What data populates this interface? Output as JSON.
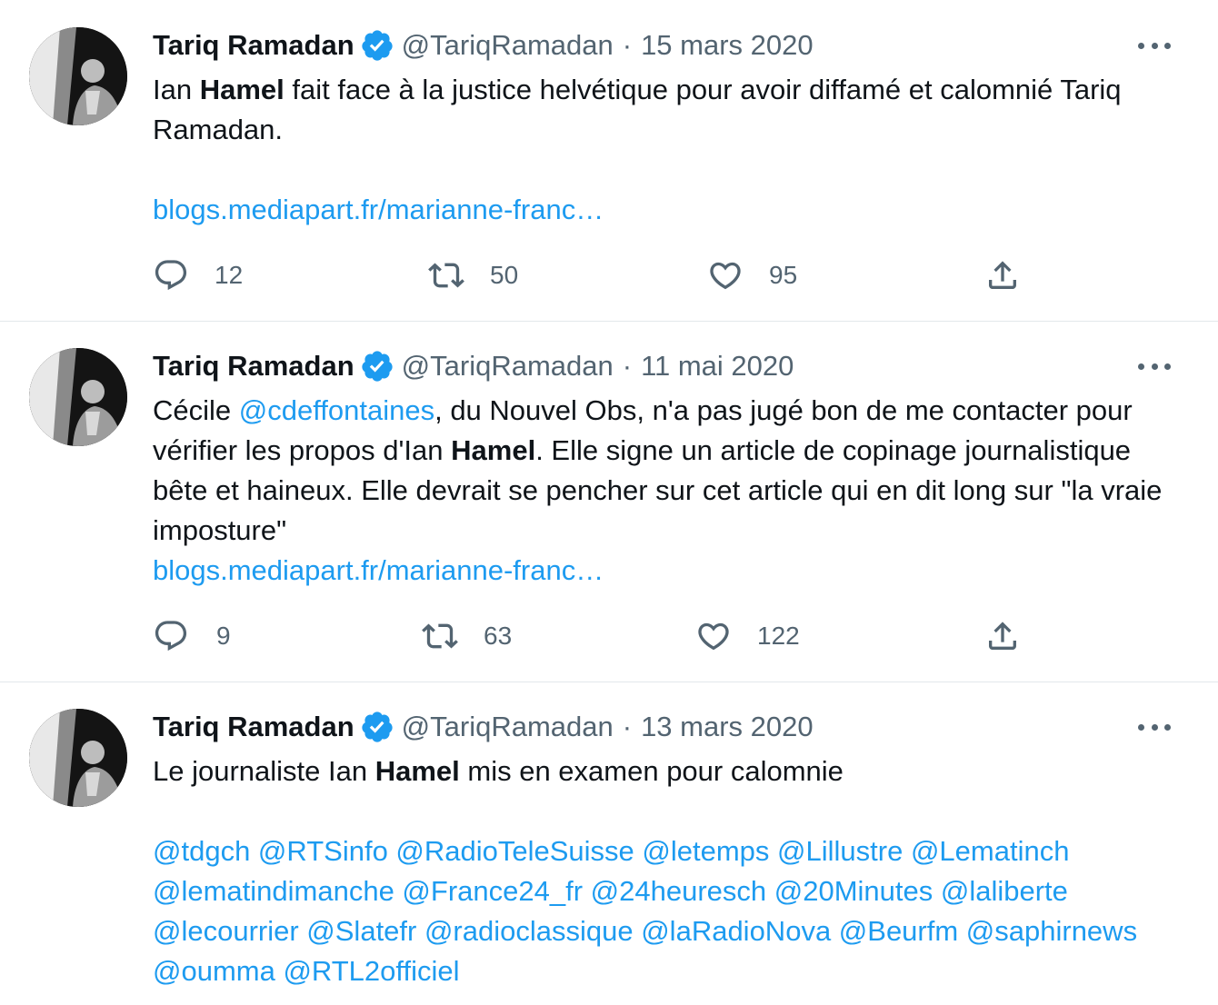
{
  "tweets": [
    {
      "author": "Tariq Ramadan",
      "handle": "@TariqRamadan",
      "dot": "·",
      "date": "15 mars 2020",
      "text": {
        "p1a": "Ian ",
        "p1b": "Hamel",
        "p1c": " fait face à la justice helvétique pour avoir diffamé et calomnié Tariq Ramadan.",
        "link": "blogs.mediapart.fr/marianne-franc…"
      },
      "replies": "12",
      "retweets": "50",
      "likes": "95"
    },
    {
      "author": "Tariq Ramadan",
      "handle": "@TariqRamadan",
      "dot": "·",
      "date": "11 mai 2020",
      "text": {
        "p1a": "Cécile ",
        "mention": "@cdeffontaines",
        "p1b": ", du Nouvel Obs, n'a pas jugé bon de me contacter pour vérifier les propos d'Ian ",
        "p1c": "Hamel",
        "p1d": ". Elle signe un article de copinage journalistique bête et haineux. Elle devrait se pencher sur cet article qui en dit long sur \"la vraie imposture\"",
        "link": "blogs.mediapart.fr/marianne-franc…"
      },
      "replies": "9",
      "retweets": "63",
      "likes": "122"
    },
    {
      "author": "Tariq Ramadan",
      "handle": "@TariqRamadan",
      "dot": "·",
      "date": "13 mars 2020",
      "text": {
        "p1a": "Le journaliste Ian ",
        "p1b": "Hamel",
        "p1c": " mis en examen pour calomnie",
        "mentions": "@tdgch @RTSinfo @RadioTeleSuisse @letemps @Lillustre @Lematinch @lematindimanche @France24_fr @24heuresch @20Minutes @laliberte @lecourrier @Slatefr @radioclassique @laRadioNova @Beurfm @saphirnews @oumma @RTL2officiel"
      }
    }
  ],
  "colors": {
    "accent": "#1d9bf0",
    "text": "#0f1419",
    "secondary": "#536471",
    "divider": "#e3e8eb"
  },
  "icons": [
    "verified-badge-icon",
    "more-icon",
    "reply-icon",
    "retweet-icon",
    "like-icon",
    "share-icon"
  ]
}
